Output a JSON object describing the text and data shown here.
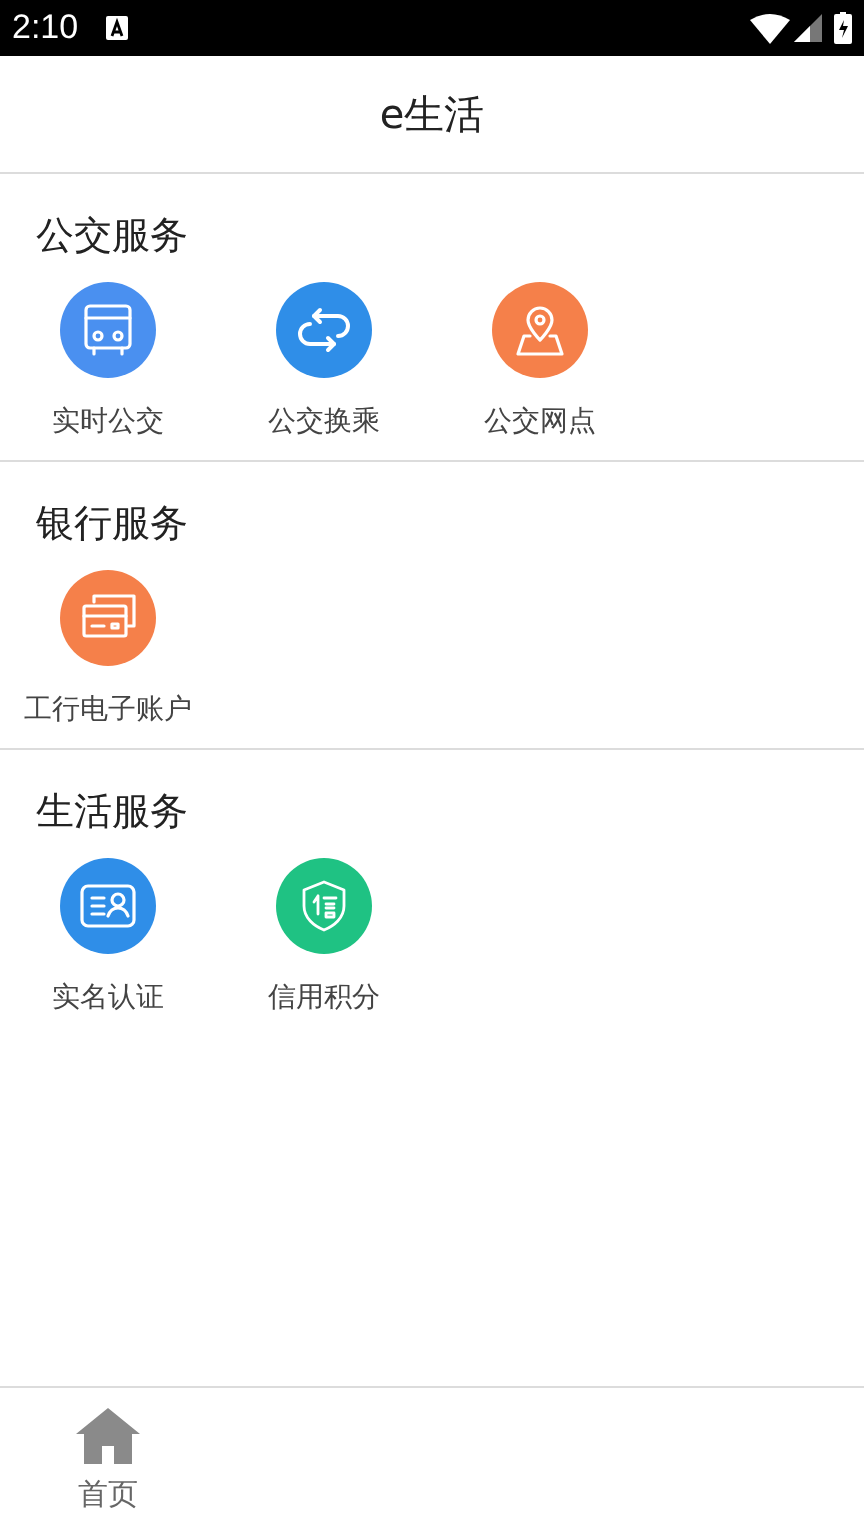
{
  "status_bar": {
    "time": "2:10"
  },
  "header": {
    "title": "e生活"
  },
  "sections": [
    {
      "title": "公交服务",
      "items": [
        {
          "label": "实时公交",
          "kind": "bus",
          "color": "#4a90f0"
        },
        {
          "label": "公交换乘",
          "kind": "transfer",
          "color": "#2f8ee8"
        },
        {
          "label": "公交网点",
          "kind": "map",
          "color": "#f5804a"
        }
      ]
    },
    {
      "title": "银行服务",
      "items": [
        {
          "label": "工行电子账户",
          "kind": "card",
          "color": "#f5804a"
        }
      ]
    },
    {
      "title": "生活服务",
      "items": [
        {
          "label": "实名认证",
          "kind": "id",
          "color": "#2f8ee8"
        },
        {
          "label": "信用积分",
          "kind": "credit",
          "color": "#1fc283"
        }
      ]
    }
  ],
  "bottom_nav": [
    {
      "label": "首页",
      "kind": "home"
    }
  ]
}
